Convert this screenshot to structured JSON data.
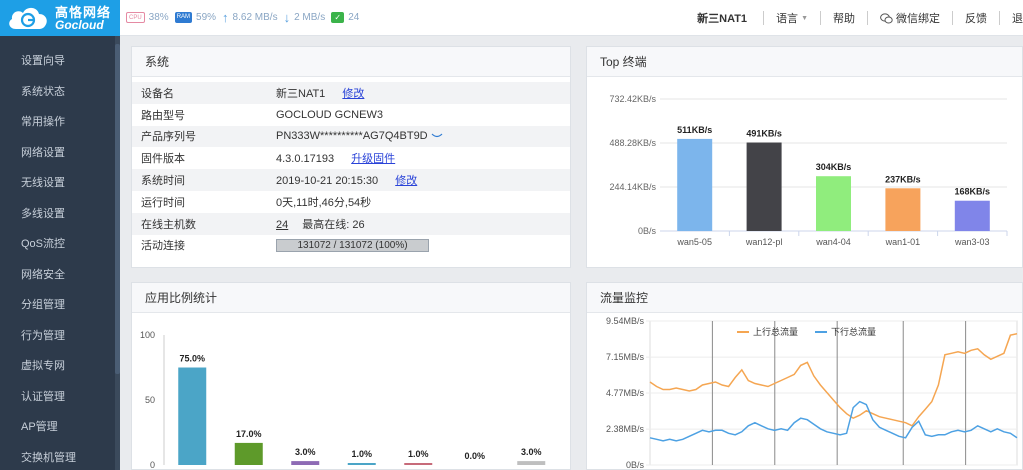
{
  "logo": {
    "cn": "高恪网络",
    "en": "Gocloud"
  },
  "sidebar": {
    "items": [
      {
        "label": "设置向导"
      },
      {
        "label": "系统状态"
      },
      {
        "label": "常用操作"
      },
      {
        "label": "网络设置"
      },
      {
        "label": "无线设置"
      },
      {
        "label": "多线设置"
      },
      {
        "label": "QoS流控"
      },
      {
        "label": "网络安全"
      },
      {
        "label": "分组管理"
      },
      {
        "label": "行为管理"
      },
      {
        "label": "虚拟专网"
      },
      {
        "label": "认证管理"
      },
      {
        "label": "AP管理"
      },
      {
        "label": "交换机管理"
      }
    ]
  },
  "topbar": {
    "cpu_chip": "CPU",
    "cpu": "38%",
    "ram_chip": "RAM",
    "ram": "59%",
    "upload_icon": "arrow-up-icon",
    "upload": "8.62 MB/s",
    "download_icon": "arrow-down-icon",
    "download": "2 MB/s",
    "online_icon": "online-check-icon",
    "online": "24",
    "device": "新三NAT1",
    "language": "语言",
    "help": "帮助",
    "wechat": "微信绑定",
    "feedback": "反馈",
    "logout": "退"
  },
  "system": {
    "title": "系统",
    "rows": {
      "device_name": {
        "label": "设备名",
        "value": "新三NAT1",
        "link": "修改"
      },
      "model": {
        "label": "路由型号",
        "value": "GOCLOUD GCNEW3"
      },
      "serial": {
        "label": "产品序列号",
        "value": "PN333W**********AG7Q4BT9D"
      },
      "firmware": {
        "label": "固件版本",
        "value": "4.3.0.17193",
        "link": "升级固件"
      },
      "time": {
        "label": "系统时间",
        "value": "2019-10-21 20:15:30",
        "link": "修改"
      },
      "uptime": {
        "label": "运行时间",
        "value": "0天,11时,46分,54秒"
      },
      "hosts": {
        "label": "在线主机数",
        "value": "24",
        "max_label": "最高在线:",
        "max": "26"
      },
      "conn": {
        "label": "活动连接",
        "text": "131072 / 131072 (100%)",
        "fraction": 1.0
      }
    }
  },
  "top_terminals": {
    "title": "Top 终端"
  },
  "app_stats": {
    "title": "应用比例统计"
  },
  "traffic": {
    "title": "流量监控"
  },
  "chart_data": [
    {
      "type": "bar",
      "title": "Top 终端",
      "categories": [
        "wan5-05",
        "wan12-pl",
        "wan4-04",
        "wan1-01",
        "wan3-03"
      ],
      "values": [
        511,
        491,
        304,
        237,
        168
      ],
      "value_labels": [
        "511KB/s",
        "491KB/s",
        "304KB/s",
        "237KB/s",
        "168KB/s"
      ],
      "colors": [
        "#7cb5ec",
        "#434348",
        "#90ed7d",
        "#f7a35c",
        "#8085e9"
      ],
      "ylim": [
        0,
        732.42
      ],
      "yticks": [
        0,
        244.14,
        488.28,
        732.42
      ],
      "ytick_labels": [
        "0B/s",
        "244.14KB/s",
        "488.28KB/s",
        "732.42KB/s"
      ]
    },
    {
      "type": "bar",
      "title": "应用比例统计",
      "values": [
        75.0,
        17.0,
        3.0,
        1.0,
        1.0,
        0.0,
        3.0
      ],
      "value_labels": [
        "75.0%",
        "17.0%",
        "3.0%",
        "1.0%",
        "1.0%",
        "0.0%",
        "3.0%"
      ],
      "colors": [
        "#4ba5c7",
        "#5e9a2a",
        "#8e6bb5",
        "#4ba5c7",
        "#c76b7a",
        "#999999",
        "#bfbfbf"
      ],
      "ylim": [
        0,
        100
      ],
      "yticks": [
        0,
        50,
        100
      ]
    },
    {
      "type": "line",
      "title": "流量监控",
      "ylim": [
        0,
        9.54
      ],
      "yticks": [
        0,
        2.38,
        4.77,
        7.15,
        9.54
      ],
      "ytick_labels": [
        "0B/s",
        "2.38MB/s",
        "4.77MB/s",
        "7.15MB/s",
        "9.54MB/s"
      ],
      "series": [
        {
          "name": "上行总流量",
          "color": "#f5a652",
          "values": [
            5.5,
            5.2,
            5.0,
            5.0,
            5.1,
            5.0,
            4.9,
            5.0,
            5.3,
            5.4,
            5.5,
            5.3,
            5.2,
            5.8,
            6.3,
            5.6,
            5.4,
            5.3,
            5.2,
            5.4,
            5.6,
            5.8,
            6.0,
            6.6,
            6.8,
            5.9,
            5.3,
            4.8,
            4.3,
            3.8,
            3.4,
            3.1,
            3.3,
            3.6,
            3.4,
            3.2,
            3.1,
            3.0,
            2.9,
            2.8,
            2.6,
            3.2,
            3.7,
            4.2,
            5.3,
            7.3,
            7.4,
            7.5,
            7.4,
            7.6,
            7.7,
            7.3,
            7.0,
            7.2,
            7.4,
            8.6,
            8.7
          ]
        },
        {
          "name": "下行总流量",
          "color": "#4da1e3",
          "values": [
            1.8,
            1.7,
            1.6,
            1.7,
            1.6,
            1.7,
            1.9,
            2.1,
            2.3,
            2.2,
            2.3,
            2.3,
            2.1,
            2.0,
            2.2,
            2.6,
            2.8,
            2.6,
            2.4,
            2.3,
            2.4,
            2.3,
            2.8,
            3.1,
            3.0,
            2.7,
            2.4,
            2.2,
            2.1,
            2.0,
            2.1,
            3.8,
            4.2,
            4.0,
            3.0,
            2.5,
            2.3,
            2.1,
            1.9,
            1.8,
            2.5,
            2.9,
            2.0,
            1.9,
            2.0,
            2.0,
            2.2,
            2.3,
            2.2,
            2.3,
            2.6,
            2.4,
            2.2,
            2.4,
            2.2,
            2.1,
            1.8
          ]
        }
      ]
    }
  ]
}
